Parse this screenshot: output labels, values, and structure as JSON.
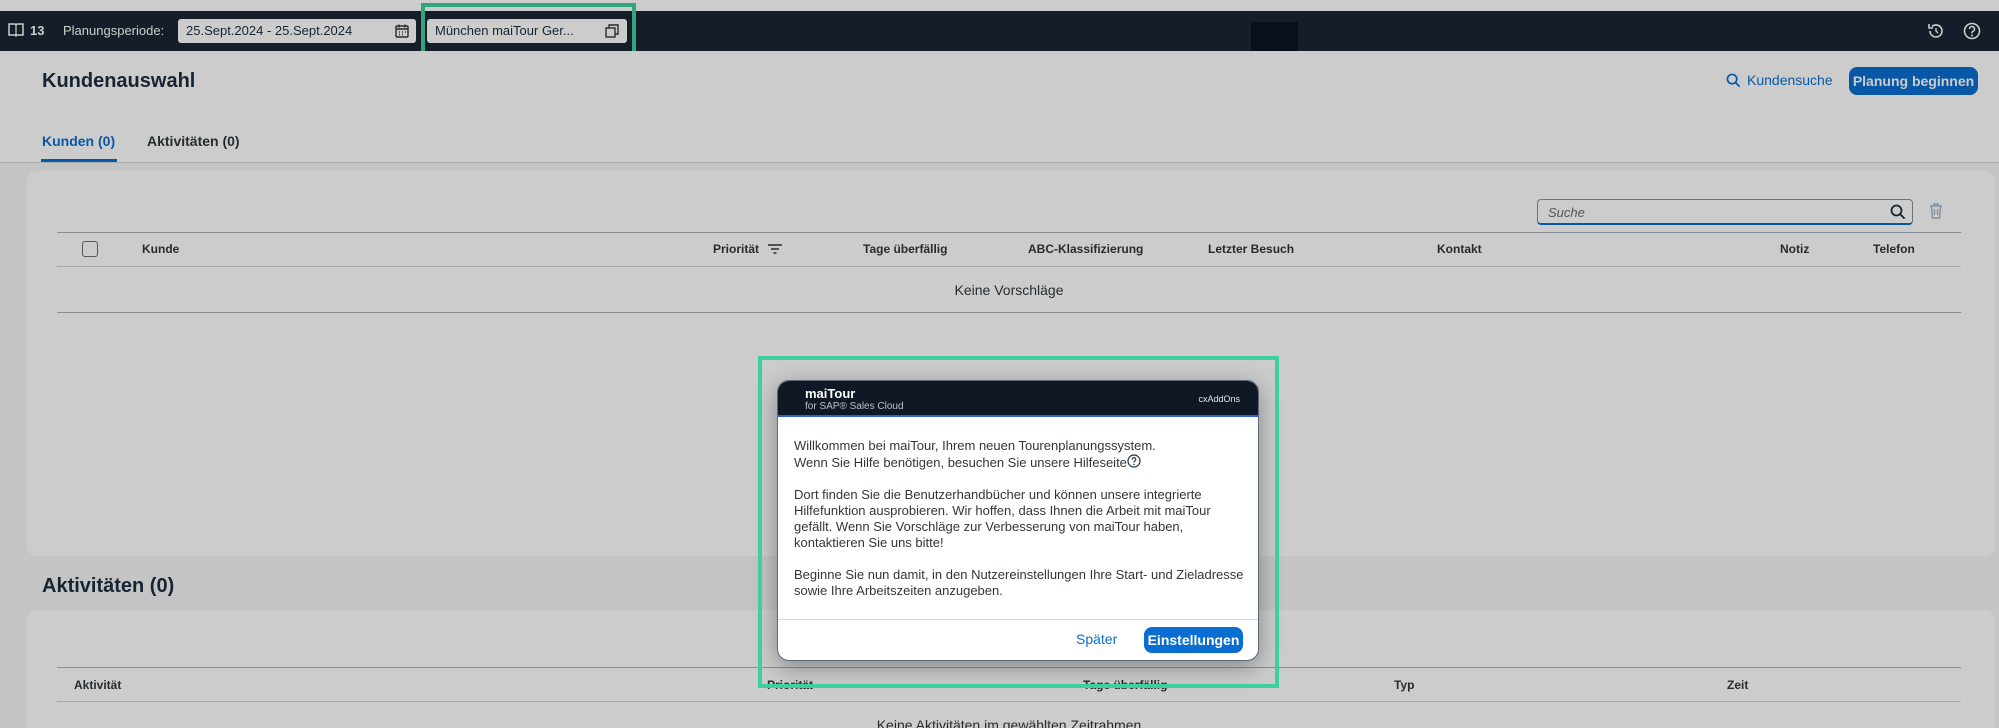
{
  "shell": {
    "count": "13",
    "planning_label": "Planungsperiode:",
    "date_range": "25.Sept.2024 - 25.Sept.2024",
    "tour_value": "München maiTour Ger..."
  },
  "header": {
    "title": "Kundenauswahl",
    "search_link": "Kundensuche",
    "start_button": "Planung beginnen",
    "tabs": [
      {
        "label": "Kunden (0)"
      },
      {
        "label": "Aktivitäten (0)"
      }
    ]
  },
  "customers_table": {
    "search_placeholder": "Suche",
    "columns": [
      "Kunde",
      "Priorität",
      "Tage überfällig",
      "ABC-Klassifizierung",
      "Letzter Besuch",
      "Kontakt",
      "Notiz",
      "Telefon"
    ],
    "empty_text": "Keine Vorschläge"
  },
  "activities": {
    "title": "Aktivitäten (0)",
    "columns": [
      "Aktivität",
      "Priorität",
      "Tage überfällig",
      "Typ",
      "Zeit"
    ],
    "empty_text": "Keine Aktivitäten im gewählten Zeitrahmen"
  },
  "dialog": {
    "brand": "maiTour",
    "brand_sub": "for SAP® Sales Cloud",
    "partner": "cxAddOns",
    "para1_line1": "Willkommen bei maiTour, Ihrem neuen Tourenplanungssystem.",
    "para1_line2": "Wenn Sie Hilfe benötigen, besuchen Sie unsere Hilfeseite",
    "para2": "Dort finden Sie die Benutzerhandbücher und können unsere integrierte Hilfefunktion ausprobieren. Wir hoffen, dass Ihnen die Arbeit mit maiTour gefällt. Wenn Sie Vorschläge zur Verbesserung von maiTour haben, kontaktieren Sie uns bitte!",
    "para3": "Beginne Sie nun damit, in den Nutzereinstellungen Ihre Start- und Zieladresse sowie Ihre Arbeitszeiten anzugeben.",
    "later_button": "Später",
    "settings_button": "Einstellungen"
  },
  "colors": {
    "accent": "#0a6ed1",
    "shell_bg": "#1b2633",
    "highlight": "#3ecf9e"
  }
}
